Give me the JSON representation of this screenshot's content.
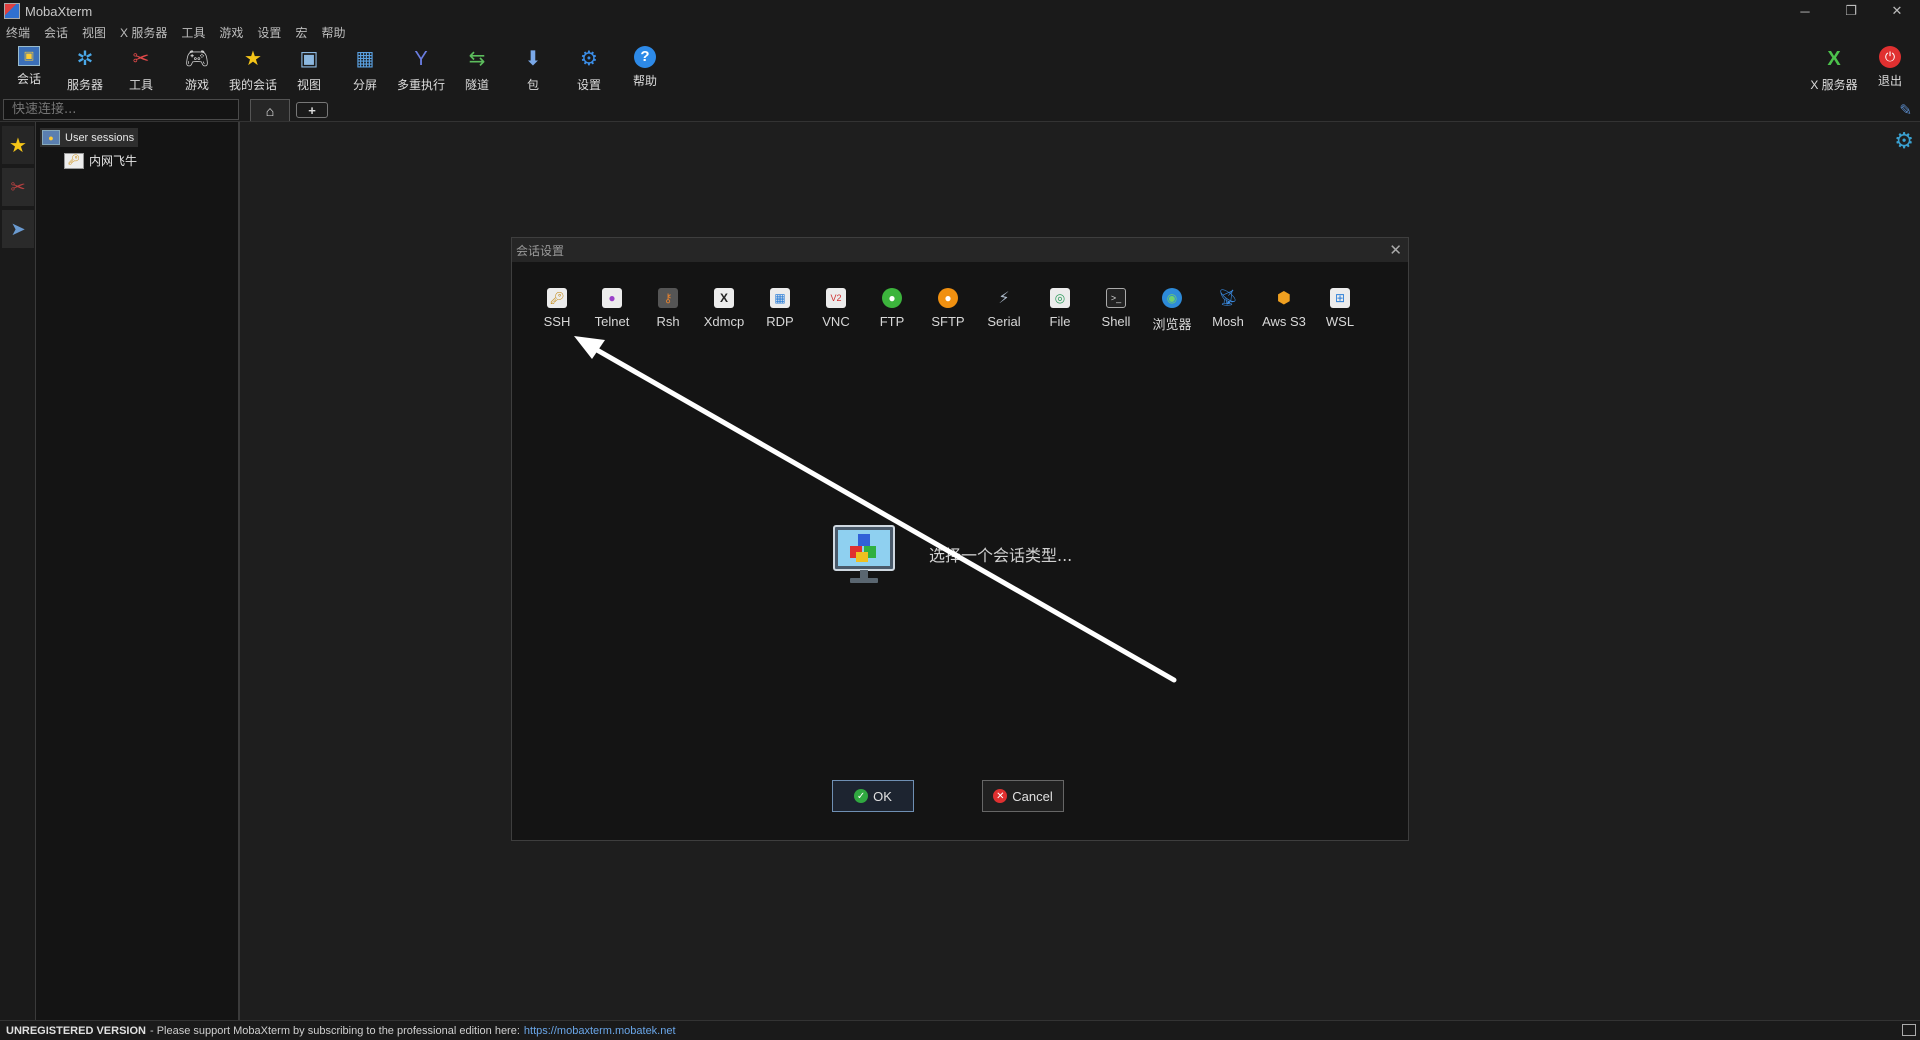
{
  "window": {
    "title": "MobaXterm"
  },
  "menu": [
    "终端",
    "会话",
    "视图",
    "X 服务器",
    "工具",
    "游戏",
    "设置",
    "宏",
    "帮助"
  ],
  "toolbar": {
    "items": [
      {
        "label": "会话",
        "icon": "session-icon"
      },
      {
        "label": "服务器",
        "icon": "servers-icon"
      },
      {
        "label": "工具",
        "icon": "tools-icon"
      },
      {
        "label": "游戏",
        "icon": "games-icon"
      },
      {
        "label": "我的会话",
        "icon": "star-icon"
      },
      {
        "label": "视图",
        "icon": "view-icon"
      },
      {
        "label": "分屏",
        "icon": "split-icon"
      },
      {
        "label": "多重执行",
        "icon": "multiexec-icon"
      },
      {
        "label": "隧道",
        "icon": "tunnel-icon"
      },
      {
        "label": "包",
        "icon": "packages-icon"
      },
      {
        "label": "设置",
        "icon": "settings-icon"
      },
      {
        "label": "帮助",
        "icon": "help-icon"
      }
    ],
    "right": [
      {
        "label": "X 服务器",
        "icon": "xserver-icon"
      },
      {
        "label": "退出",
        "icon": "power-icon"
      }
    ]
  },
  "quick_connect": {
    "placeholder": "快速连接..."
  },
  "sessions": {
    "root": "User sessions",
    "children": [
      "内网飞牛"
    ]
  },
  "dialog": {
    "title": "会话设置",
    "types": [
      "SSH",
      "Telnet",
      "Rsh",
      "Xdmcp",
      "RDP",
      "VNC",
      "FTP",
      "SFTP",
      "Serial",
      "File",
      "Shell",
      "浏览器",
      "Mosh",
      "Aws S3",
      "WSL"
    ],
    "prompt": "选择一个会话类型...",
    "ok": "OK",
    "cancel": "Cancel"
  },
  "status": {
    "bold": "UNREGISTERED VERSION",
    "text": " -  Please support MobaXterm by subscribing to the professional edition here:",
    "url": "https://mobaxterm.mobatek.net"
  }
}
